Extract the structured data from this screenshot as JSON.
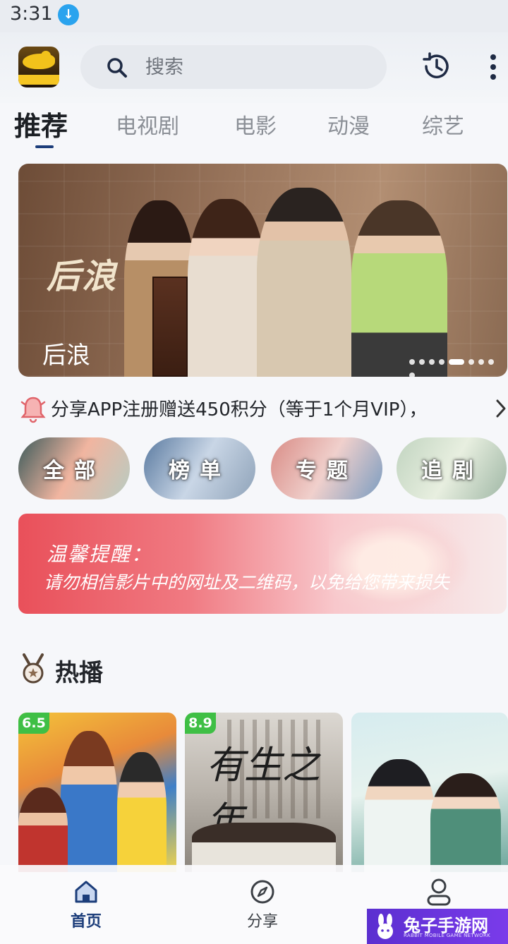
{
  "status_bar": {
    "time": "3:31",
    "download_icon": "download-arrow-icon"
  },
  "header": {
    "logo_icon": "bird-logo-icon",
    "search": {
      "placeholder": "搜索",
      "value": ""
    },
    "history_icon": "history-clock-icon",
    "more_icon": "more-vertical-icon"
  },
  "tabs": [
    {
      "label": "推荐",
      "active": true
    },
    {
      "label": "电视剧",
      "active": false
    },
    {
      "label": "电影",
      "active": false
    },
    {
      "label": "动漫",
      "active": false
    },
    {
      "label": "综艺",
      "active": false
    }
  ],
  "banner": {
    "title": "后浪",
    "calligraphy": "后浪",
    "dot_count": 9,
    "active_dot": 4
  },
  "notice": {
    "text": "分享APP注册赠送450积分（等于1个月VIP），",
    "icon": "bell-icon"
  },
  "quick_entries": [
    {
      "label": "全部"
    },
    {
      "label": "榜单"
    },
    {
      "label": "专题"
    },
    {
      "label": "追剧"
    }
  ],
  "warning": {
    "title": "温馨提醒：",
    "text": "请勿相信影片中的网址及二维码，以免给您带来损失"
  },
  "hot": {
    "title": "热播",
    "icon": "medal-icon",
    "items": [
      {
        "score": "6.5"
      },
      {
        "score": "8.9",
        "poster_text": "有生之年"
      },
      {
        "score": ""
      }
    ]
  },
  "bottom_nav": [
    {
      "label": "首页",
      "icon": "home-icon",
      "active": true
    },
    {
      "label": "分享",
      "icon": "compass-icon",
      "active": false
    },
    {
      "label": "",
      "icon": "user-icon",
      "active": false
    }
  ],
  "watermark": {
    "title": "兔子手游网",
    "subtitle": "RABBIT MOBILE GAME NETWORK"
  },
  "colors": {
    "accent": "#1c3d7a",
    "score_badge": "#3fbf45",
    "warning": "#e9505a",
    "watermark": "#5b2fd0"
  }
}
